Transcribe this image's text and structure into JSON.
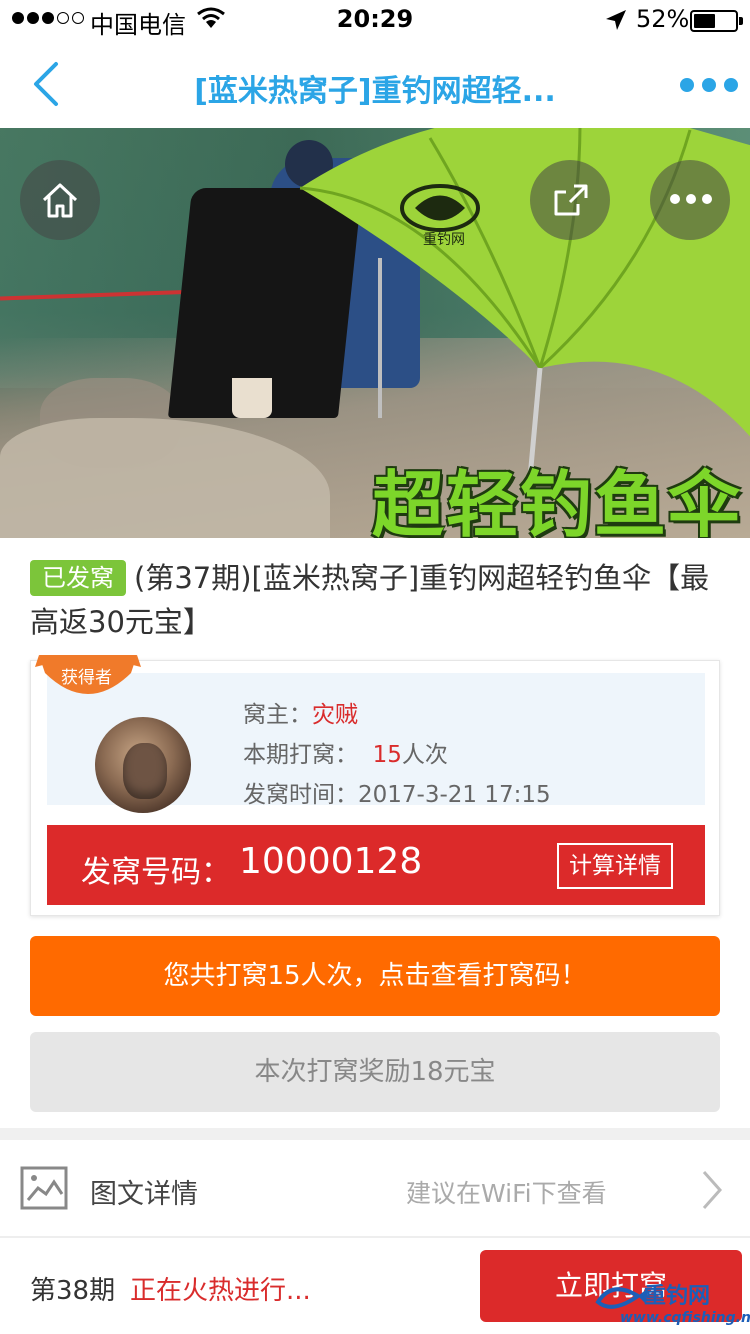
{
  "status_bar": {
    "carrier": "中国电信",
    "time": "20:29",
    "battery_pct": "52%",
    "battery_level": 0.52,
    "signal_bars": 3
  },
  "nav": {
    "title": "[蓝米热窝子]重钓网超轻...",
    "back_icon": "chevron-left-icon",
    "more_icon": "ellipsis-icon",
    "accent": "#2ba5e6"
  },
  "hero": {
    "banner_text": "超轻钓鱼伞",
    "logo_text": "重钓网",
    "icons": [
      "home-icon",
      "share-icon",
      "ellipsis-icon"
    ]
  },
  "product": {
    "badge": "已发窝",
    "title": "(第37期)[蓝米热窝子]重钓网超轻钓鱼伞【最高返30元宝】",
    "badge_color": "#7cc53a"
  },
  "winner": {
    "ribbon": "获得者",
    "owner_label": "窝主：",
    "owner_name": "灾贼",
    "count_label": "本期打窝：",
    "count_value": "15",
    "count_unit": "人次",
    "time_label": "发窝时间：",
    "time_value": "2017-3-21 17:15",
    "code_label": "发窝号码：",
    "code_value": "10000128",
    "calc_button": "计算详情"
  },
  "actions": {
    "view_codes": "您共打窝15人次，点击查看打窝码！",
    "reward": "本次打窝奖励18元宝"
  },
  "detail": {
    "label": "图文详情",
    "hint": "建议在WiFi下查看"
  },
  "bottom": {
    "period": "第38期",
    "status": "正在火热进行...",
    "join_button": "立即打窝"
  },
  "watermark": {
    "brand": "重钓网",
    "url": "www.cqfishing.net"
  },
  "colors": {
    "red": "#dc2a2a",
    "orange": "#ff6a00",
    "green": "#7cc53a",
    "blue": "#2ba5e6"
  }
}
